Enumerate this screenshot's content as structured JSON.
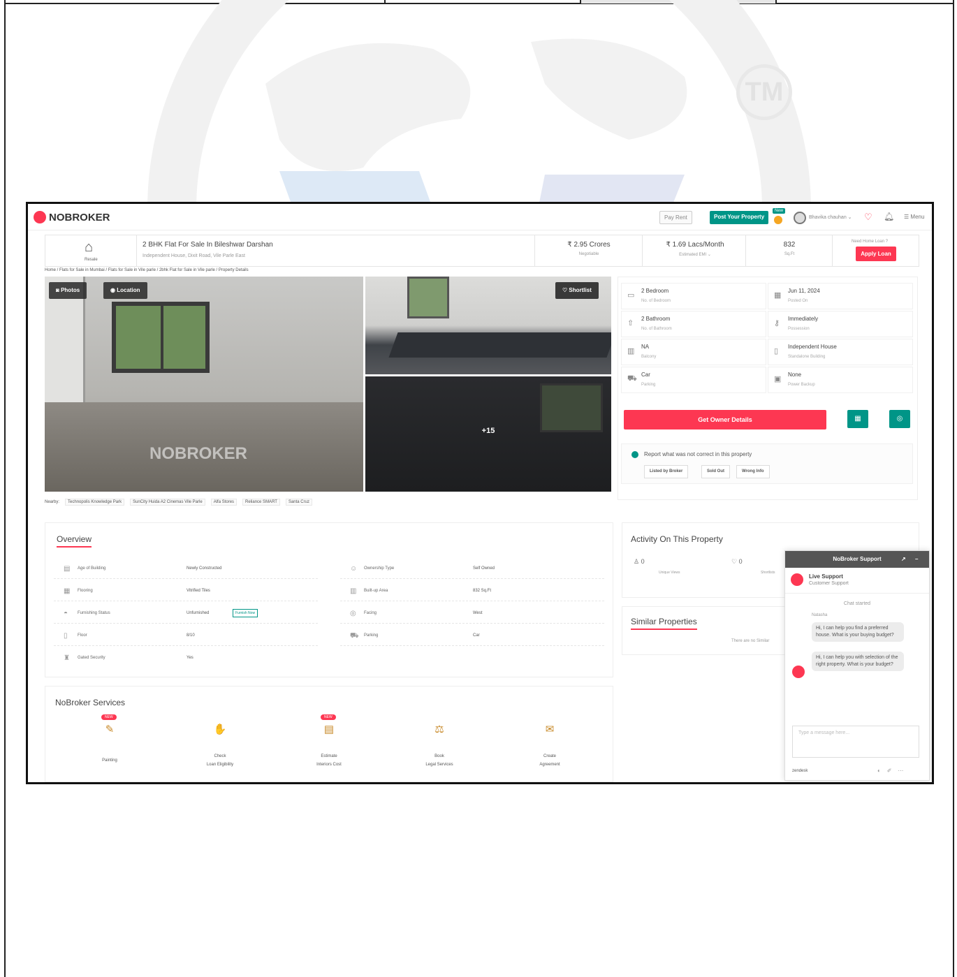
{
  "header": {
    "brand": "NOBROKER",
    "pay_rent": "Pay Rent",
    "post_property": "Post Your Property",
    "new_badge": "New",
    "user_name": "Bhavika chauhan",
    "menu": "Menu"
  },
  "summary": {
    "type_label": "Resale",
    "title": "2 BHK Flat For Sale In Bileshwar Darshan",
    "address": "Independent House, Dixit Road, Vile Parle East",
    "price": "₹ 2.95 Crores",
    "price_sub": "Negotiable",
    "emi": "₹ 1.69 Lacs/Month",
    "emi_sub": "Estimated EMI",
    "area": "832",
    "area_sub": "Sq.Ft",
    "need_loan": "Need Home Loan ?",
    "apply_loan": "Apply Loan"
  },
  "breadcrumb": "Home / Flats for Sale in Mumbai / Flats for Sale in Vile parle / 2bhk Flat for Sale in Vile parle / Property Details",
  "gallery": {
    "photos": "Photos",
    "location": "Location",
    "shortlist": "Shortlist",
    "more": "+15",
    "watermark": "NOBROKER"
  },
  "nearby": {
    "label": "Nearby:",
    "items": [
      "Technopolis Knowledge Park",
      "SunCity Huida A2 Cinemas Vile Parle",
      "Alfa Stores",
      "Reliance SMART",
      "Santa Cruz"
    ]
  },
  "details": [
    {
      "value": "2 Bedroom",
      "sub": "No. of Bedroom",
      "icon": "bed-icon"
    },
    {
      "value": "Jun 11, 2024",
      "sub": "Posted On",
      "icon": "calendar-icon"
    },
    {
      "value": "2 Bathroom",
      "sub": "No. of Bathroom",
      "icon": "bath-icon"
    },
    {
      "value": "Immediately",
      "sub": "Possession",
      "icon": "key-icon"
    },
    {
      "value": "NA",
      "sub": "Balcony",
      "icon": "balcony-icon"
    },
    {
      "value": "Independent House",
      "sub": "Standalone Building",
      "icon": "building-icon"
    },
    {
      "value": "Car",
      "sub": "Parking",
      "icon": "car-icon"
    },
    {
      "value": "None",
      "sub": "Power Backup",
      "icon": "battery-icon"
    }
  ],
  "actions": {
    "get_owner": "Get Owner Details"
  },
  "report": {
    "text": "Report what was not correct in this property",
    "buttons": [
      "Listed by Broker",
      "Sold Out",
      "Wrong Info"
    ]
  },
  "overview": {
    "title": "Overview",
    "left": [
      {
        "label": "Age of Building",
        "value": "Newly Constructed"
      },
      {
        "label": "Flooring",
        "value": "Vitrified Tiles"
      },
      {
        "label": "Furnishing Status",
        "value": "Unfurnished"
      },
      {
        "label": "Floor",
        "value": "8/10"
      },
      {
        "label": "Gated Security",
        "value": "Yes"
      }
    ],
    "right": [
      {
        "label": "Ownership Type",
        "value": "Self Owned"
      },
      {
        "label": "Built-up Area",
        "value": "832 Sq.Ft"
      },
      {
        "label": "Facing",
        "value": "West"
      },
      {
        "label": "Parking",
        "value": "Car"
      }
    ],
    "furnish_now": "Furnish Now"
  },
  "services": {
    "title": "NoBroker Services",
    "new_badge": "NEW",
    "items": [
      {
        "label": "Painting",
        "new": true
      },
      {
        "label": "Check\nLoan Eligibility",
        "new": false
      },
      {
        "label": "Estimate\nInteriors Cost",
        "new": true
      },
      {
        "label": "Book\nLegal Services",
        "new": false
      },
      {
        "label": "Create\nAgreement",
        "new": false
      }
    ]
  },
  "activity": {
    "title": "Activity On This Property",
    "views": "0",
    "views_label": "Unique Views",
    "shortlists": "0",
    "shortlists_label": "Shortlists"
  },
  "similar": {
    "title": "Similar Properties",
    "empty": "There are no Similar"
  },
  "chat": {
    "title": "NoBroker Support",
    "live": "Live Support",
    "live_sub": "Customer Support",
    "started": "Chat started",
    "agent": "Natasha",
    "msg1": "Hi, I can help you find a preferred house. What is your buying budget?",
    "msg2": "Hi, I can help you with selection of the right property. What is your budget?",
    "placeholder": "Type a message here...",
    "footer": "zendesk"
  },
  "colors": {
    "brand": "#fd3752",
    "teal": "#009587"
  }
}
